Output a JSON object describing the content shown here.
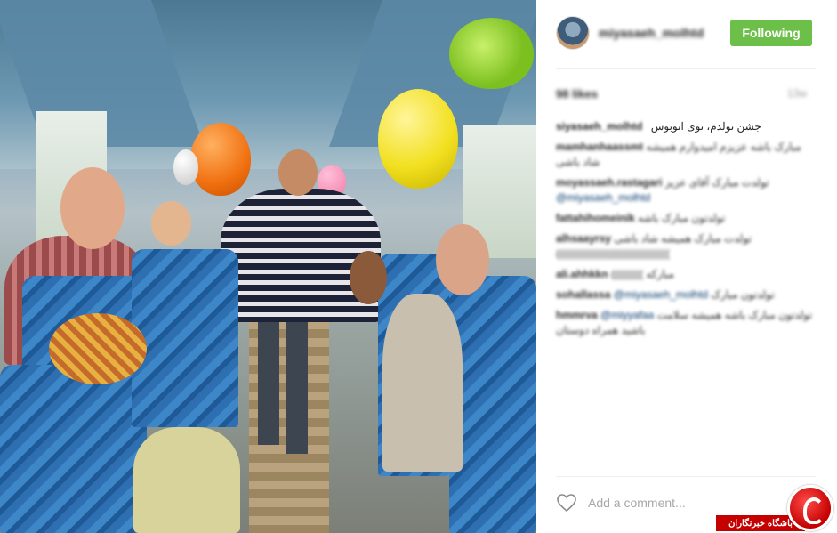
{
  "post": {
    "image_alt": "",
    "header": {
      "username": "miyasaeh_molhtd",
      "follow_label": "Following"
    },
    "likes_text": "98 likes",
    "time_ago": "13w",
    "caption": {
      "username": "siyasaeh_molhtd",
      "text": "جشن تولدم، توی اتوبوس"
    },
    "comments": [
      {
        "user": "mamhanhaassmt",
        "text": "مبارک باشه عزیزم امیدوارم همیشه شاد باشی",
        "mention": ""
      },
      {
        "user": "moyassaeh.rastagari",
        "text": "تولدت مبارک آقای عزیز",
        "mention": "@miyasaeh_molhtd"
      },
      {
        "user": "fattahihomeinik",
        "text": "تولدتون مبارک باشه",
        "mention": ""
      },
      {
        "user": "alhsaayrsy",
        "text": "تولدت مبارک همیشه شاد باشی ((((((((((((((((((((((((((((((((",
        "mention": ""
      },
      {
        "user": "ali.ahhkkn",
        "text": "((((((((( مبارکه",
        "mention": ""
      },
      {
        "user": "sohallassa",
        "text": "تولدتون مبارک",
        "mention": "@miyasaeh_molhtd"
      },
      {
        "user": "hmmrva",
        "text": "تولدتون مبارک باشه همیشه سلامت باشید همراه دوستان",
        "mention": "@miyyafaa"
      }
    ],
    "add_comment_placeholder": "Add a comment..."
  },
  "icons": {
    "like": "heart-icon"
  },
  "watermark": {
    "text": "باشگاه خبرنگاران",
    "color": "#c40000"
  },
  "colors": {
    "follow_button": "#6cc04a",
    "mention": "#003569"
  }
}
